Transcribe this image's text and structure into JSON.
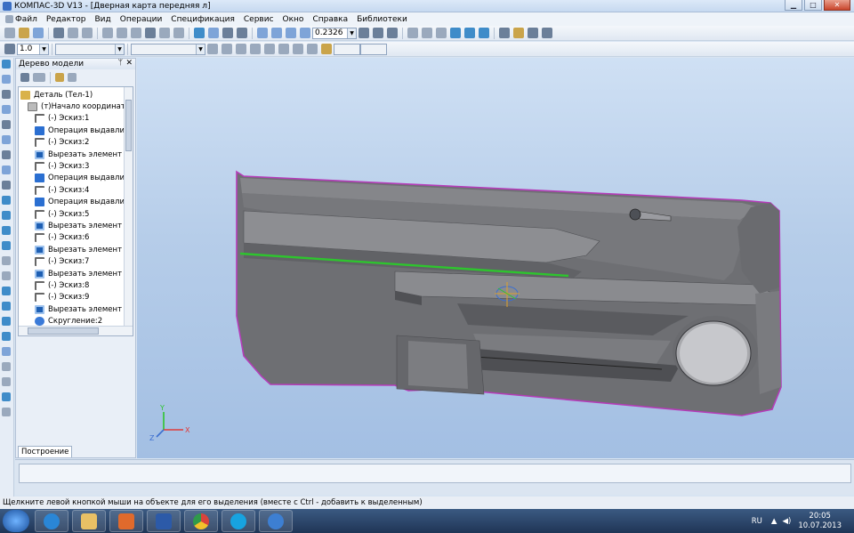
{
  "window": {
    "title": "КОМПАС-3D V13 - [Дверная карта передняя л]"
  },
  "menu": [
    "Файл",
    "Редактор",
    "Вид",
    "Операции",
    "Спецификация",
    "Сервис",
    "Окно",
    "Справка",
    "Библиотеки"
  ],
  "toolbar": {
    "zoom_value": "0.2326",
    "step_value": "1.0"
  },
  "tree_panel": {
    "title": "Дерево модели",
    "items": [
      {
        "label": "Деталь (Тел-1)",
        "icon": "part-icon"
      },
      {
        "label": "(т)Начало координат",
        "icon": "origin-icon"
      },
      {
        "label": "(-) Эскиз:1",
        "icon": "sketch-icon"
      },
      {
        "label": "Операция выдавливания",
        "icon": "extrude-icon"
      },
      {
        "label": "(-) Эскиз:2",
        "icon": "sketch-icon"
      },
      {
        "label": "Вырезать элемент выдавливания",
        "icon": "cut-icon"
      },
      {
        "label": "(-) Эскиз:3",
        "icon": "sketch-icon"
      },
      {
        "label": "Операция выдавливания",
        "icon": "extrude-icon"
      },
      {
        "label": "(-) Эскиз:4",
        "icon": "sketch-icon"
      },
      {
        "label": "Операция выдавливания",
        "icon": "extrude-icon"
      },
      {
        "label": "(-) Эскиз:5",
        "icon": "sketch-icon"
      },
      {
        "label": "Вырезать элемент выдавливания",
        "icon": "cut-icon"
      },
      {
        "label": "(-) Эскиз:6",
        "icon": "sketch-icon"
      },
      {
        "label": "Вырезать элемент выдавливания",
        "icon": "cut-icon"
      },
      {
        "label": "(-) Эскиз:7",
        "icon": "sketch-icon"
      },
      {
        "label": "Вырезать элемент выдавливания",
        "icon": "cut-icon"
      },
      {
        "label": "(-) Эскиз:8",
        "icon": "sketch-icon"
      },
      {
        "label": "(-) Эскиз:9",
        "icon": "sketch-icon"
      },
      {
        "label": "Вырезать элемент выдавливания",
        "icon": "cut-icon"
      },
      {
        "label": "Скругление:2",
        "icon": "fillet-icon"
      }
    ],
    "tab": "Построение"
  },
  "triad": {
    "y": "Y",
    "z": "Z",
    "x": "X"
  },
  "status_hint": "Щелкните левой кнопкой мыши на объекте для его выделения (вместе с Ctrl - добавить к выделенным)",
  "taskbar": {
    "lang": "RU",
    "time": "20:05",
    "date": "10.07.2013"
  },
  "colors": {
    "part_fill": "#6e6f73",
    "part_edge": "#b43cb8",
    "selected_edge": "#2ec42e",
    "viewport_bg": "#b6cde9"
  }
}
